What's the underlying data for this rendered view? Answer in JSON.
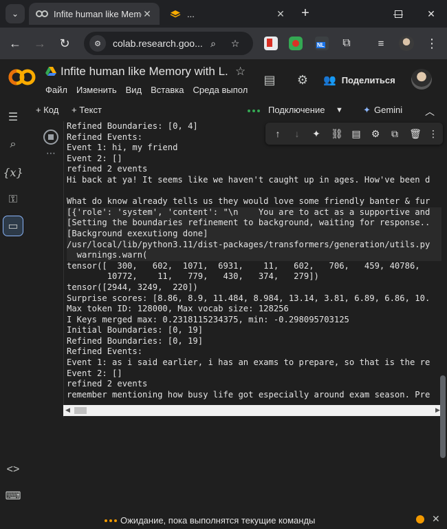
{
  "browser": {
    "tabs": [
      {
        "title": "Infite human like Memo",
        "active": true
      },
      {
        "title": "...",
        "active": false
      }
    ],
    "url": "colab.research.goo...",
    "extension_badge": "NL"
  },
  "colab": {
    "logo_text": "CO",
    "notebook_title": "Infite human like Memory with L...",
    "menus": [
      "Файл",
      "Изменить",
      "Вид",
      "Вставка",
      "Среда выпол"
    ],
    "share_label": "Поделиться"
  },
  "notebook_toolbar": {
    "add_code": "+ Код",
    "add_text": "+ Текст",
    "connection_label": "Подключение",
    "gemini_label": "Gemini"
  },
  "output_lines": [
    "Refined Boundaries: [0, 4]",
    "Refined Events:",
    "Event 1: hi, my friend",
    "Event 2: []",
    "refined 2 events",
    "Hi back at ya! It seems like we haven't caught up in ages. How've been d",
    "",
    "What do know already tells us they would love some friendly banter & fur",
    "[{'role': 'system', 'content': \"\\n    You are to act as a supportive and",
    "[Setting the boundaries refinement to background, waiting for response..",
    "[Background exexutiong done]",
    "/usr/local/lib/python3.11/dist-packages/transformers/generation/utils.py",
    "  warnings.warn(",
    "tensor([  300,   602,  1071,  6931,    11,   602,   706,   459, 40786,",
    "        10772,    11,   779,   430,   374,   279])",
    "tensor([2944, 3249,  220])",
    "Surprise scores: [8.86, 8.9, 11.484, 8.984, 13.14, 3.81, 6.89, 6.86, 10.",
    "Max token ID: 128000, Max vocab size: 128256",
    "I Keys merged max: 0.2318115234375, min: -0.298095703125",
    "Initial Boundaries: [0, 19]",
    "Refined Boundaries: [0, 19]",
    "Refined Events:",
    "Event 1: as i said earlier, i has an exams to prepare, so that is the re",
    "Event 2: []",
    "refined 2 events",
    "remember mentioning how busy life got especially around exam season. Pre"
  ],
  "status": {
    "text": "Ожидание, пока выполнятся текущие команды"
  },
  "colors": {
    "background": "#1f1f1f",
    "tab_active": "#35363a",
    "accent_orange": "#f29900",
    "accent_green": "#34a853",
    "colab_orange": "#f9ab00"
  }
}
